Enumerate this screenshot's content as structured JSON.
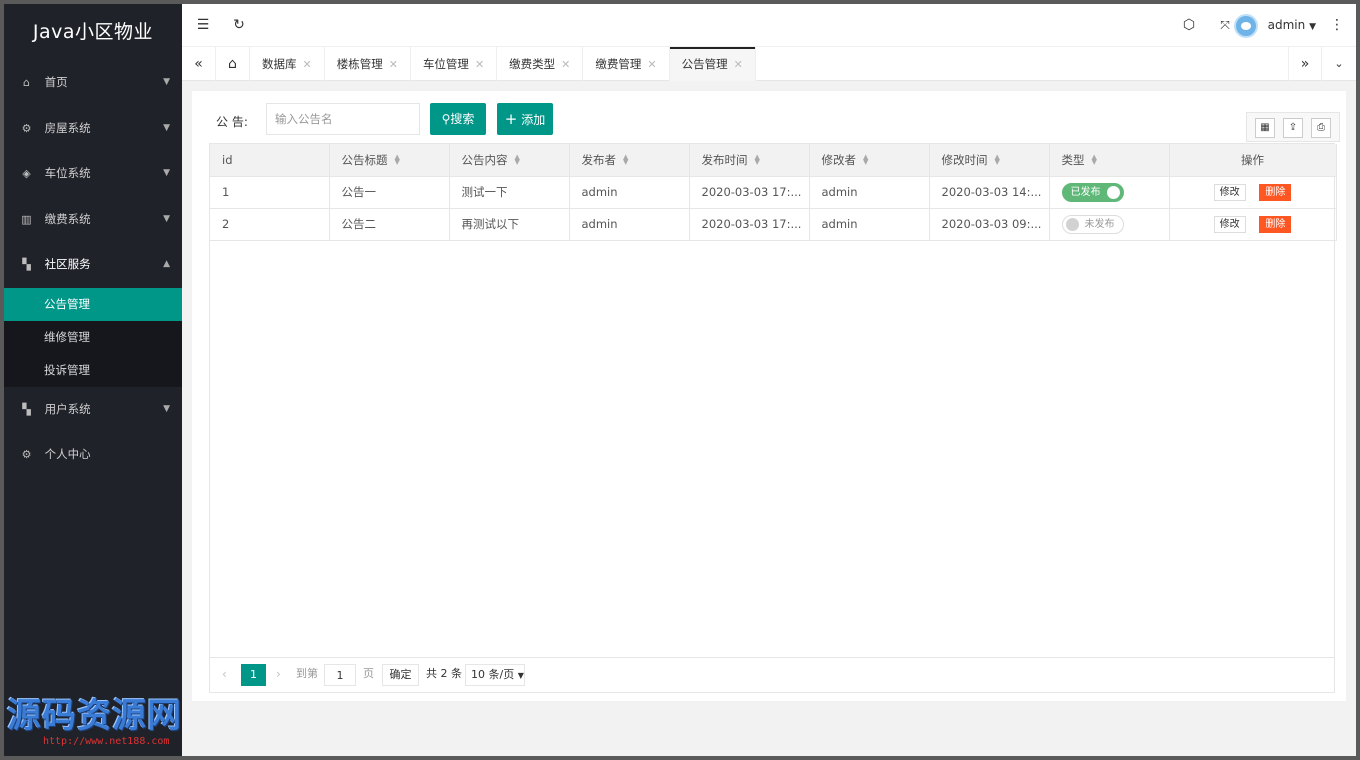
{
  "app": {
    "title": "Java小区物业"
  },
  "sidebar": {
    "items": [
      {
        "label": "首页",
        "icon": "home-icon",
        "expanded": false
      },
      {
        "label": "房屋系统",
        "icon": "gear-icon",
        "expanded": false
      },
      {
        "label": "车位系统",
        "icon": "cube-icon",
        "expanded": false
      },
      {
        "label": "缴费系统",
        "icon": "book-icon",
        "expanded": false
      },
      {
        "label": "社区服务",
        "icon": "apps-icon",
        "expanded": true
      },
      {
        "label": "用户系统",
        "icon": "apps-icon",
        "expanded": false
      },
      {
        "label": "个人中心",
        "icon": "gear-icon",
        "expanded": false
      }
    ],
    "submenu": [
      {
        "label": "公告管理",
        "active": true
      },
      {
        "label": "维修管理",
        "active": false
      },
      {
        "label": "投诉管理",
        "active": false
      }
    ]
  },
  "header": {
    "user": "admin"
  },
  "tabs": {
    "items": [
      "数据库",
      "楼栋管理",
      "车位管理",
      "缴费类型",
      "缴费管理",
      "公告管理"
    ],
    "active_index": 5
  },
  "search": {
    "label": "公 告:",
    "placeholder": "输入公告名",
    "value": "",
    "search_button": "搜索",
    "add_button": "添加"
  },
  "table": {
    "columns": [
      "id",
      "公告标题",
      "公告内容",
      "发布者",
      "发布时间",
      "修改者",
      "修改时间",
      "类型",
      "操作"
    ],
    "rows": [
      {
        "id": "1",
        "title": "公告一",
        "content": "测试一下",
        "publisher": "admin",
        "publish_time": "2020-03-03 17:...",
        "modifier": "admin",
        "modify_time": "2020-03-03 14:...",
        "status": "已发布",
        "published": true,
        "edit": "修改",
        "delete": "删除"
      },
      {
        "id": "2",
        "title": "公告二",
        "content": "再测试以下",
        "publisher": "admin",
        "publish_time": "2020-03-03 17:...",
        "modifier": "admin",
        "modify_time": "2020-03-03 09:...",
        "status": "未发布",
        "published": false,
        "edit": "修改",
        "delete": "删除"
      }
    ]
  },
  "pagination": {
    "current_page": "1",
    "goto_prefix": "到第",
    "goto_value": "1",
    "goto_suffix": "页",
    "confirm": "确定",
    "total": "共 2 条",
    "page_size": "10 条/页"
  },
  "watermark": {
    "text": "源码资源网",
    "url": "http://www.net188.com"
  },
  "colors": {
    "accent": "#009688",
    "sidebar": "#20222a",
    "danger": "#ff5722",
    "switch_on": "#5fb878"
  }
}
